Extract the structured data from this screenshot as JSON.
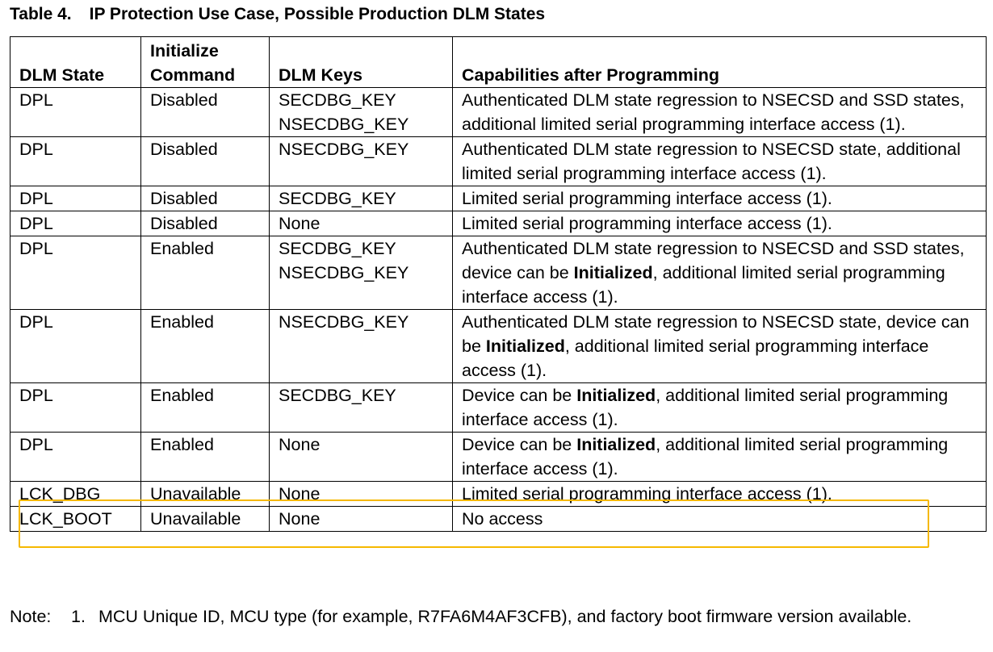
{
  "caption": {
    "number": "Table 4.",
    "title": "IP Protection Use Case, Possible Production DLM States"
  },
  "headers": {
    "state": "DLM State",
    "init1": "Initialize",
    "init2": "Command",
    "keys": "DLM Keys",
    "caps": "Capabilities after Programming"
  },
  "rows": [
    {
      "state": "DPL",
      "init": "Disabled",
      "keys": [
        "SECDBG_KEY",
        "NSECDBG_KEY"
      ],
      "caps": [
        {
          "t": "Authenticated DLM state regression to NSECSD and SSD states, additional limited serial programming interface access (1).",
          "b": false
        }
      ]
    },
    {
      "state": "DPL",
      "init": "Disabled",
      "keys": [
        "NSECDBG_KEY"
      ],
      "caps": [
        {
          "t": "Authenticated DLM state regression to NSECSD state, additional limited serial programming interface access (1).",
          "b": false
        }
      ]
    },
    {
      "state": "DPL",
      "init": "Disabled",
      "keys": [
        "SECDBG_KEY"
      ],
      "caps": [
        {
          "t": "Limited serial programming interface access (1).",
          "b": false
        }
      ]
    },
    {
      "state": "DPL",
      "init": "Disabled",
      "keys": [
        "None"
      ],
      "caps": [
        {
          "t": "Limited serial programming interface access (1).",
          "b": false
        }
      ]
    },
    {
      "state": "DPL",
      "init": "Enabled",
      "keys": [
        "SECDBG_KEY",
        "NSECDBG_KEY"
      ],
      "caps": [
        {
          "t": "Authenticated DLM state regression to NSECSD and SSD states, device can be ",
          "b": false
        },
        {
          "t": "Initialized",
          "b": true
        },
        {
          "t": ", additional limited serial programming interface access (1).",
          "b": false
        }
      ]
    },
    {
      "state": "DPL",
      "init": "Enabled",
      "keys": [
        "NSECDBG_KEY"
      ],
      "caps": [
        {
          "t": "Authenticated DLM state regression to NSECSD state, device can be ",
          "b": false
        },
        {
          "t": "Initialized",
          "b": true
        },
        {
          "t": ", additional limited serial programming interface access (1).",
          "b": false
        }
      ]
    },
    {
      "state": "DPL",
      "init": "Enabled",
      "keys": [
        "SECDBG_KEY"
      ],
      "caps": [
        {
          "t": "Device can be ",
          "b": false
        },
        {
          "t": "Initialized",
          "b": true
        },
        {
          "t": ", additional limited serial programming interface access (1).",
          "b": false
        }
      ]
    },
    {
      "state": "DPL",
      "init": "Enabled",
      "keys": [
        "None"
      ],
      "caps": [
        {
          "t": "Device can be ",
          "b": false
        },
        {
          "t": "Initialized",
          "b": true
        },
        {
          "t": ", additional limited serial programming interface access (1).",
          "b": false
        }
      ]
    },
    {
      "state": "LCK_DBG",
      "init": "Unavailable",
      "keys": [
        "None"
      ],
      "caps": [
        {
          "t": "Limited serial programming interface access (1).",
          "b": false
        }
      ]
    },
    {
      "state": "LCK_BOOT",
      "init": "Unavailable",
      "keys": [
        "None"
      ],
      "caps": [
        {
          "t": "No access",
          "b": false
        }
      ]
    }
  ],
  "note": {
    "label": "Note:",
    "num": "1.",
    "text": "MCU Unique ID, MCU type (for example, R7FA6M4AF3CFB), and factory boot firmware version available."
  },
  "highlight": {
    "row_index": 7,
    "color": "#f5b800"
  }
}
